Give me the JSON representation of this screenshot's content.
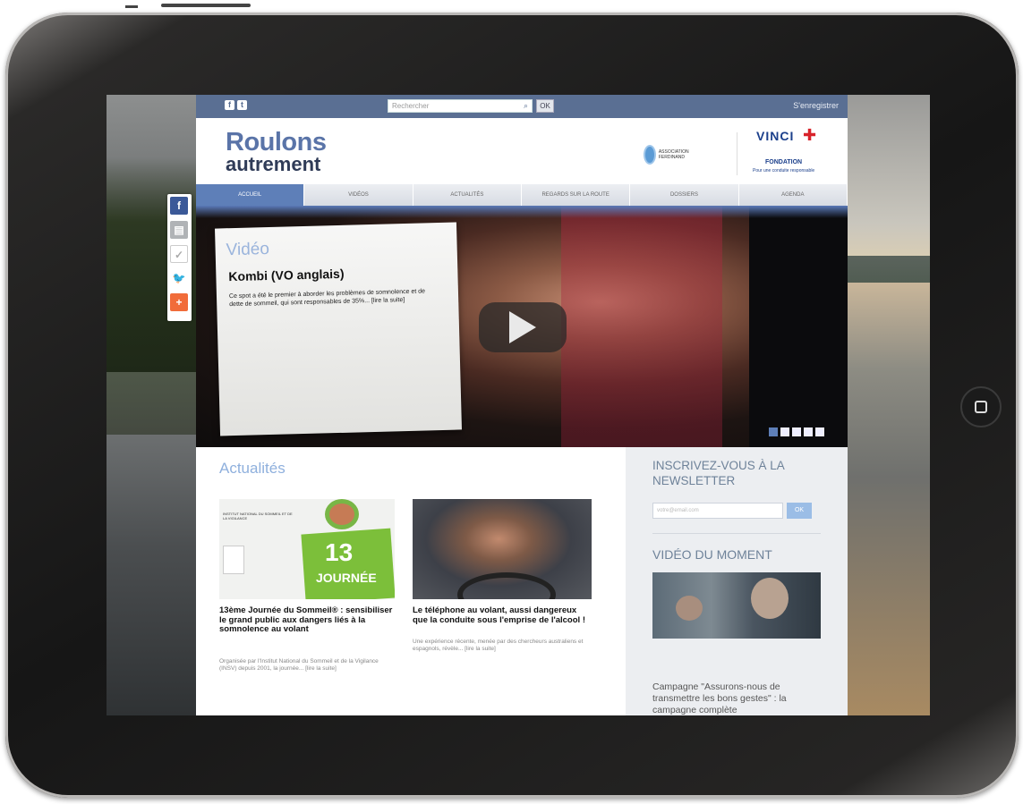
{
  "topbar": {
    "social_icons": [
      "facebook-icon",
      "twitter-icon"
    ],
    "search_placeholder": "Rechercher",
    "ok_label": "OK",
    "register_label": "S'enregistrer"
  },
  "header": {
    "logo_line1": "Roulons",
    "logo_line2": "autrement",
    "partner1_name": "ASSOCIATION FERDINAND",
    "partner2_name": "VINCI",
    "partner2_sub": "FONDATION",
    "partner2_tag": "Pour une conduite responsable"
  },
  "nav": [
    "ACCUEIL",
    "VIDÉOS",
    "ACTUALITÉS",
    "REGARDS SUR LA ROUTE",
    "DOSSIERS",
    "AGENDA"
  ],
  "hero": {
    "kicker": "Vidéo",
    "title": "Kombi (VO anglais)",
    "description": "Ce spot a été le premier à aborder les problèmes de somnolence et de dette de sommeil, qui sont responsables de 35%... [lire la suite]",
    "active_slide": 1,
    "slides": 5
  },
  "news": {
    "section_title": "Actualités",
    "items": [
      {
        "image_text_number": "13",
        "image_text_label": "JOURNÉE",
        "image_small_text": "INSTITUT NATIONAL DU SOMMEIL ET DE LA VIGILANCE",
        "headline": "13ème Journée du Sommeil® : sensibiliser le grand public aux dangers liés à la somnolence au volant",
        "summary": "Organisée par l'Institut National du Sommeil et de la Vigilance (INSV) depuis 2001, la journée... [lire la suite]"
      },
      {
        "headline": "Le téléphone au volant, aussi dangereux que la conduite sous l'emprise de l'alcool !",
        "summary": "Une expérience récente, menée par des chercheurs australiens et espagnols, révèle... [lire la suite]"
      }
    ]
  },
  "aside": {
    "newsletter_title": "INSCRIVEZ-VOUS À LA NEWSLETTER",
    "newsletter_placeholder": "votre@email.com",
    "newsletter_button": "OK",
    "video_title": "VIDÉO DU MOMENT",
    "campaign_text": "Campagne \"Assurons-nous de transmettre les bons gestes\" : la campagne complète"
  },
  "share_icons": [
    "facebook-icon",
    "print-icon",
    "mail-icon",
    "twitter-icon",
    "plus-icon"
  ],
  "colors": {
    "topbar": "#5a6f93",
    "nav_active": "#5e7fb8",
    "logo_blue": "#5a74a8",
    "accent_light": "#8fb0dd"
  }
}
